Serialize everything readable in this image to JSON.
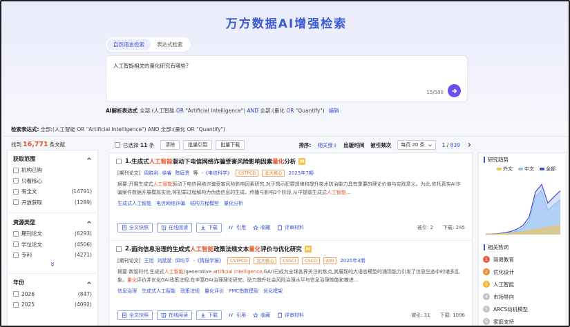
{
  "header": {
    "title": "万方数据AI增强检索"
  },
  "mode_tabs": [
    {
      "label": "自然语言检索",
      "active": true
    },
    {
      "label": "表达式检索",
      "active": false
    }
  ],
  "query": {
    "text": "人工智能相关的量化研究有哪些?",
    "count": "15/500"
  },
  "ai_expression": {
    "label": "AI解析表达式",
    "p1": "全部:(人工智能 ",
    "k1": "OR",
    "p2": " \"Artificial Intelligence\") ",
    "k2": "AND",
    "p3": " 全部:(量化 ",
    "k3": "OR",
    "p4": " \"Quantify\")",
    "edit": "编辑"
  },
  "search_expression": {
    "label": "检索表达式:",
    "text": "全部:(人工智能 OR \"Artificial Intelligence\") AND 全部:(量化 OR \"Quantify\")"
  },
  "found": {
    "prefix": "找到",
    "count": "16,771",
    "suffix": "条文献"
  },
  "filters": {
    "access": {
      "title": "获取范围",
      "items": [
        {
          "label": "机构已购",
          "count": ""
        },
        {
          "label": "只看核心",
          "count": ""
        },
        {
          "label": "有全文",
          "count": "(14791)"
        },
        {
          "label": "开放获取",
          "count": "(1289)"
        }
      ]
    },
    "resource": {
      "title": "资源类型",
      "items": [
        {
          "label": "期刊论文",
          "count": "(6293)"
        },
        {
          "label": "学位论文",
          "count": "(4506)"
        },
        {
          "label": "专利",
          "count": "(4271)"
        }
      ]
    },
    "year": {
      "title": "年份",
      "items": [
        {
          "label": "2026",
          "count": "(847)"
        },
        {
          "label": "2025",
          "count": "(4092)"
        }
      ]
    }
  },
  "toolbar": {
    "selected_prefix": "已选择",
    "selected_count": "11",
    "selected_suffix": "条",
    "clear": "清除",
    "batch_cite": "批量引用",
    "batch_download": "批量下载",
    "sort_label": "排序:",
    "sort_relevance": "相关度↓",
    "sort_time": "出版时间",
    "sort_cited": "被引频次",
    "per_page": "每页 20 条",
    "page_current": "1",
    "page_sep": " / ",
    "page_total": "839"
  },
  "results": [
    {
      "index": "1.",
      "title_pre": "生成式",
      "title_hl1": "人工智能",
      "title_mid": "驱动下电信网络诈骗受害风险影响因素",
      "title_hl2": "量化",
      "title_post": "分析",
      "type": "[期刊论文]",
      "authors": [
        "周胜利",
        "徐睿",
        "陈庭贵"
      ],
      "etal": "等",
      "journal": "-《电信科学》",
      "tags": [
        "CSTPCD",
        "北大核心"
      ],
      "year": "2025年7期",
      "abstract": "摘要:开展生成式人工智能驱动下电信网络诈骗受害风险影响因素研究,对于揭示犯罪规律和提升技术防治能力具有重要的理论价值与实践意义。为此,依托真实AI诈骗案件数据开展模拟实验,将犯罪过程解构为伪造信息的生成、传播与影响3个阶段,从中提取生成式人工智能...",
      "keywords": [
        "生成式人工智能",
        "电信网络诈骗",
        "结构方程模型",
        "量化分析"
      ],
      "actions": {
        "fulltext": "全文快照",
        "read": "在线阅读",
        "download": "下载",
        "cite": "引用",
        "fav": "收藏",
        "review": "评审材料"
      },
      "cited": "被引: 2",
      "downloads": "下载: 245"
    },
    {
      "index": "2.",
      "title_pre": "面向信息治理的生成式",
      "title_hl1": "人工智能",
      "title_mid": "政策法规文本",
      "title_hl2": "量化",
      "title_post": "评价与优化研究",
      "type": "[期刊论文]",
      "authors": [
        "王旭",
        "刘斌斌",
        "邱均平"
      ],
      "etal": "",
      "journal": "-《情报学报》",
      "tags": [
        "CSTPCD",
        "北大核心",
        "CSSCI",
        "CSCD",
        "AMI"
      ],
      "year": "2025年3期",
      "abstract": "摘要:数智时代,生成式人工智能(generative artificial intelligence,GAI)已成为全球各界关注的焦点,其展现的大语言模型的涌现能力引发了信息生态中的诸多乱象。量化评价并优化GAI政策法规,在丰富GAI治理理论研究、助力提升社会风险治理水平与信息治理效能和推进...",
      "keywords": [
        "信息治理",
        "生成式人工智能",
        "政策法规",
        "量化评价",
        "PMC指数模型",
        "优化框架"
      ],
      "actions": {
        "fulltext": "全文快照",
        "read": "在线阅读",
        "download": "下载",
        "cite": "引用",
        "fav": "收藏",
        "review": "评审材料"
      },
      "cited": "被引: 31",
      "downloads": "下载: 1096"
    }
  ],
  "trend": {
    "title": "研究趋势",
    "legend": [
      {
        "name": "外文",
        "color": "#f5c24b"
      },
      {
        "name": "中文",
        "color": "#8fc1f5"
      },
      {
        "name": "全部",
        "color": "#3a55d2"
      }
    ]
  },
  "chart_data": {
    "type": "area",
    "series": [
      {
        "name": "外文",
        "values": [
          2,
          3,
          4,
          8,
          14,
          22,
          35,
          45,
          60,
          75,
          88,
          100,
          115
        ]
      },
      {
        "name": "中文",
        "values": [
          2,
          4,
          8,
          15,
          25,
          45,
          80,
          180,
          480,
          560,
          310,
          380,
          440
        ]
      },
      {
        "name": "全部",
        "values": [
          4,
          7,
          12,
          23,
          39,
          67,
          115,
          225,
          540,
          635,
          398,
          480,
          555
        ]
      }
    ],
    "ylim": [
      0,
      700
    ]
  },
  "hot": {
    "title": "相关热词",
    "items": [
      {
        "rank": "1",
        "label": "简易教育",
        "color": "#e65a3b"
      },
      {
        "rank": "2",
        "label": "优化设计",
        "color": "#f08a2c"
      },
      {
        "rank": "3",
        "label": "人工智能",
        "color": "#f5b52e"
      },
      {
        "rank": "4",
        "label": "市场导向",
        "color": "#bfc3cc"
      },
      {
        "rank": "5",
        "label": "ARCS动机模型",
        "color": "#bfc3cc"
      },
      {
        "rank": "6",
        "label": "家庭支持",
        "color": "#bfc3cc"
      }
    ]
  }
}
